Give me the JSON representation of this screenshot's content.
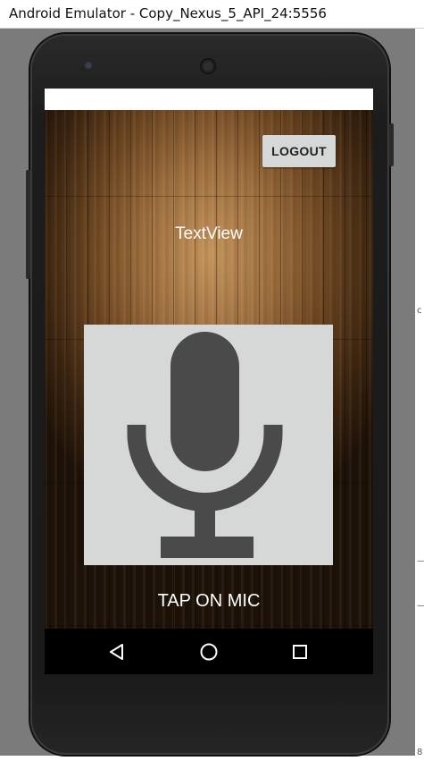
{
  "window": {
    "title": "Android Emulator - Copy_Nexus_5_API_24:5556"
  },
  "app": {
    "logout_label": "LOGOUT",
    "textview_text": "TextView",
    "tap_hint": "TAP ON MIC"
  },
  "icons": {
    "mic": "microphone-icon",
    "back": "back-triangle-icon",
    "home": "home-circle-icon",
    "recents": "recents-square-icon"
  },
  "colors": {
    "button_bg": "#d6d7d7",
    "mic_glyph": "#4a4a4a",
    "label_text": "#ffffff"
  }
}
